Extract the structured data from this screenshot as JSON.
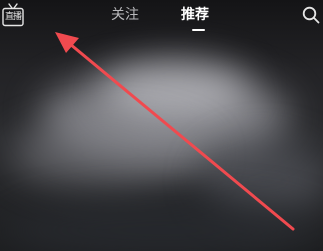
{
  "header": {
    "live_label": "直播",
    "tabs": [
      {
        "label": "关注",
        "active": false
      },
      {
        "label": "推荐",
        "active": true
      }
    ]
  },
  "icons": {
    "live": "tv-icon",
    "search": "search-icon"
  },
  "colors": {
    "annotation_arrow": "#f04a4f",
    "active_tab": "#ffffff",
    "inactive_tab": "#b9b9bc"
  }
}
